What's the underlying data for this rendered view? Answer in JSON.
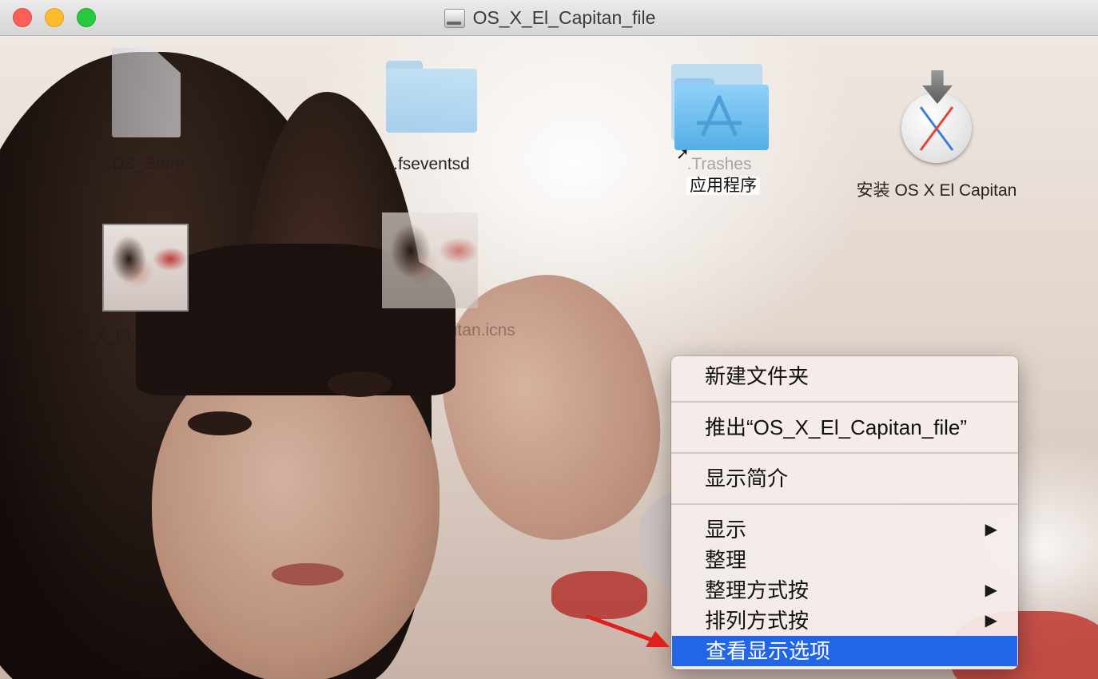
{
  "window": {
    "title": "OS_X_El_Capitan_file",
    "title_icon": "drive-icon"
  },
  "desktop_items": [
    {
      "label": ".DS_Store",
      "icon": "document-icon",
      "style": "faint"
    },
    {
      "label": ".fseventsd",
      "icon": "folder-icon",
      "style": "dark"
    },
    {
      "label": ".Trashes",
      "icon": "folder-icon",
      "style": "faint"
    },
    {
      "label": "应用程序",
      "icon": "applications-folder-alias-icon",
      "style": "highlighted"
    },
    {
      "label": "安装 OS X El Capitan",
      "icon": "installer-icon",
      "style": "dark"
    },
    {
      "label": "OS_X_El_Capitan.png",
      "icon": "image-thumbnail",
      "style": "faint"
    },
    {
      "label": "OS_X_El_Capitan.icns",
      "icon": "image-thumbnail",
      "style": "faint"
    }
  ],
  "context_menu": {
    "items": [
      {
        "label": "新建文件夹"
      },
      {
        "label": "推出“OS_X_El_Capitan_file”"
      },
      {
        "label": "显示简介"
      },
      {
        "label": "显示",
        "submenu": "▶"
      },
      {
        "label": "整理"
      },
      {
        "label": "整理方式按",
        "submenu": "▶"
      },
      {
        "label": "排列方式按",
        "submenu": "▶"
      },
      {
        "label": "查看显示选项",
        "selected": true
      }
    ]
  },
  "colors": {
    "menu_selection": "#2266e8",
    "annotation_arrow": "#e0201a"
  }
}
